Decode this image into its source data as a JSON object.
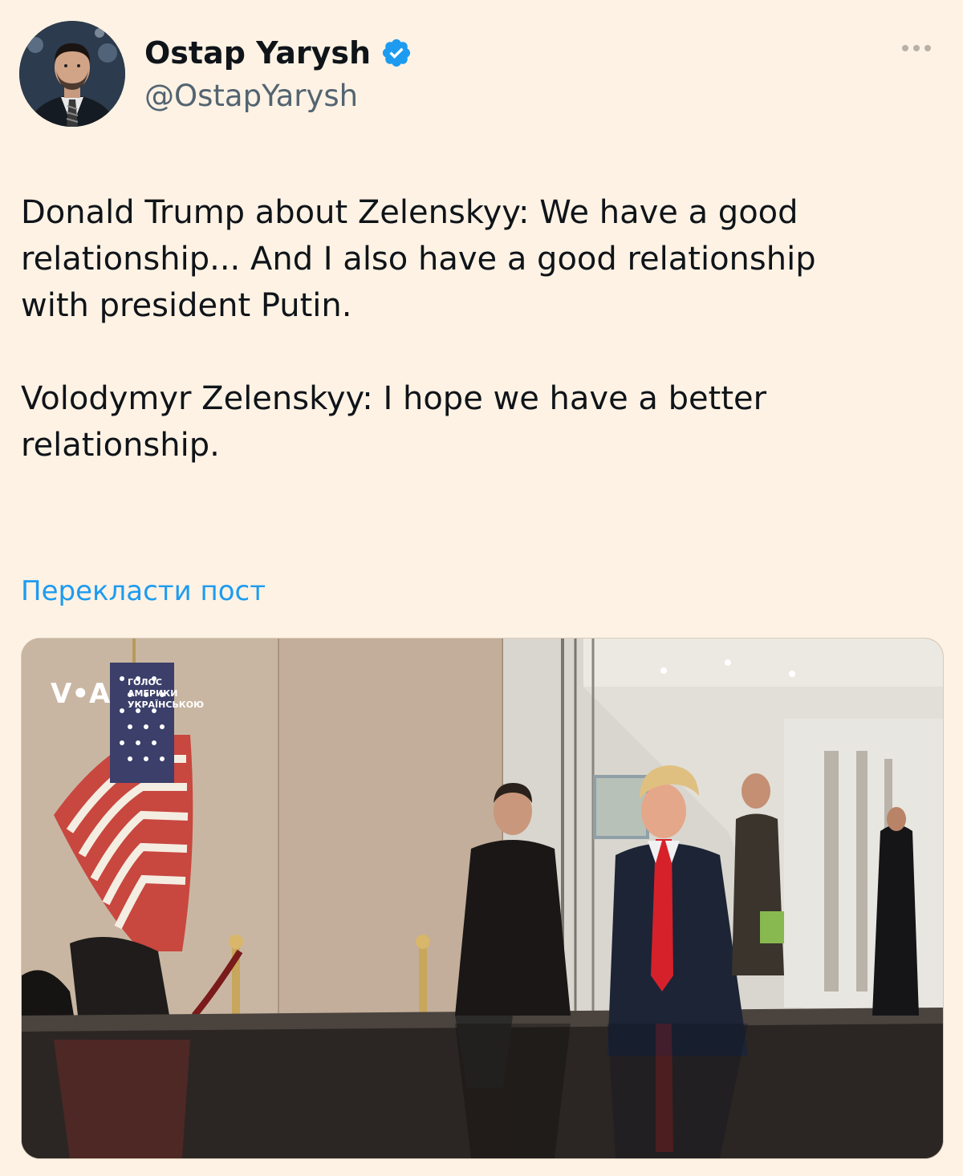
{
  "author": {
    "display_name": "Ostap Yarysh",
    "handle": "@OstapYarysh",
    "verified": true
  },
  "tweet": {
    "paragraphs": [
      "Donald Trump about Zelenskyy: We have a good\nrelationship... And I also have a good relationship\nwith president Putin.",
      "Volodymyr Zelenskyy: I hope we have a better\nrelationship."
    ],
    "translate_label": "Перекласти пост"
  },
  "media": {
    "watermark": {
      "logo": "V•A",
      "lines": [
        "ГОЛОС",
        "АМЕРИКИ",
        "УКРАЇНСЬКОЮ"
      ]
    }
  },
  "colors": {
    "background": "#fdf2e4",
    "text": "#0f1419",
    "secondary": "#536471",
    "link": "#1d9bf0",
    "verified": "#1d9bf0"
  },
  "icons": {
    "verified": "verified-badge-icon",
    "more": "more-horizontal-icon"
  }
}
